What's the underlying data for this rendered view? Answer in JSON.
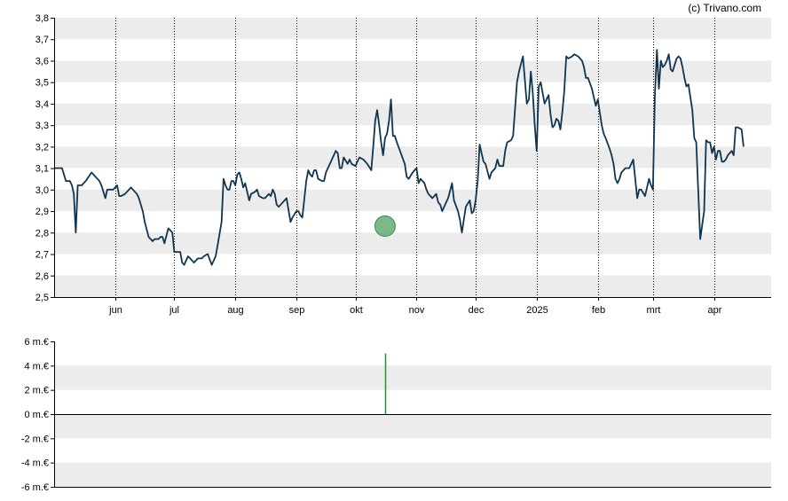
{
  "credit": "(c) Trivano.com",
  "colors": {
    "price_line": "#0f3550",
    "volume_bar": "#2e8b3a",
    "marker": "#5aa86a",
    "band": "#ececec",
    "axis": "#000000",
    "grid": "#000000"
  },
  "chart_data": [
    {
      "type": "line",
      "ylim": [
        2.5,
        3.8
      ],
      "yticks": [
        "2,5",
        "2,6",
        "2,7",
        "2,8",
        "2,9",
        "3,0",
        "3,1",
        "3,2",
        "3,3",
        "3,4",
        "3,5",
        "3,6",
        "3,7",
        "3,8"
      ],
      "ytick_values": [
        2.5,
        2.6,
        2.7,
        2.8,
        2.9,
        3.0,
        3.1,
        3.2,
        3.3,
        3.4,
        3.5,
        3.6,
        3.7,
        3.8
      ],
      "xlim": [
        "2024-05-01",
        "2025-04-30"
      ],
      "xticks": [
        {
          "label": "jun",
          "date": "2024-06-01"
        },
        {
          "label": "jul",
          "date": "2024-07-01"
        },
        {
          "label": "aug",
          "date": "2024-08-01"
        },
        {
          "label": "sep",
          "date": "2024-09-01"
        },
        {
          "label": "okt",
          "date": "2024-10-01"
        },
        {
          "label": "nov",
          "date": "2024-11-01"
        },
        {
          "label": "dec",
          "date": "2024-12-01"
        },
        {
          "label": "2025",
          "date": "2025-01-01"
        },
        {
          "label": "feb",
          "date": "2025-02-01"
        },
        {
          "label": "mrt",
          "date": "2025-03-01"
        },
        {
          "label": "apr",
          "date": "2025-04-01"
        }
      ],
      "grid": "vertical dotted at month starts, alternating horizontal bands",
      "x": [
        "2024-05-01",
        "2024-05-05",
        "2024-05-07",
        "2024-05-09",
        "2024-05-10",
        "2024-05-11",
        "2024-05-12",
        "2024-05-13",
        "2024-05-15",
        "2024-05-17",
        "2024-05-20",
        "2024-05-21",
        "2024-05-22",
        "2024-05-23",
        "2024-05-24",
        "2024-05-25",
        "2024-05-27",
        "2024-05-28",
        "2024-05-29",
        "2024-05-30",
        "2024-05-31",
        "2024-06-02",
        "2024-06-03",
        "2024-06-04",
        "2024-06-06",
        "2024-06-08",
        "2024-06-09",
        "2024-06-10",
        "2024-06-11",
        "2024-06-12",
        "2024-06-13",
        "2024-06-14",
        "2024-06-15",
        "2024-06-16",
        "2024-06-18",
        "2024-06-20",
        "2024-06-21",
        "2024-06-22",
        "2024-06-23",
        "2024-06-24",
        "2024-06-25",
        "2024-06-26",
        "2024-06-28",
        "2024-06-30",
        "2024-07-01",
        "2024-07-02",
        "2024-07-03",
        "2024-07-04",
        "2024-07-05",
        "2024-07-06",
        "2024-07-07",
        "2024-07-08",
        "2024-07-09",
        "2024-07-11",
        "2024-07-13",
        "2024-07-14",
        "2024-07-15",
        "2024-07-16",
        "2024-07-18",
        "2024-07-20",
        "2024-07-22",
        "2024-07-23",
        "2024-07-25",
        "2024-07-26",
        "2024-07-27",
        "2024-07-28",
        "2024-07-29",
        "2024-07-30",
        "2024-07-31",
        "2024-08-01",
        "2024-08-02",
        "2024-08-03",
        "2024-08-04",
        "2024-08-05",
        "2024-08-06",
        "2024-08-08",
        "2024-08-09",
        "2024-08-11",
        "2024-08-12",
        "2024-08-13",
        "2024-08-15",
        "2024-08-16",
        "2024-08-18",
        "2024-08-19",
        "2024-08-20",
        "2024-08-21",
        "2024-08-22",
        "2024-08-23",
        "2024-08-24",
        "2024-08-26",
        "2024-08-27",
        "2024-08-29",
        "2024-08-30",
        "2024-09-01",
        "2024-09-02",
        "2024-09-03",
        "2024-09-04",
        "2024-09-06",
        "2024-09-07",
        "2024-09-08",
        "2024-09-09",
        "2024-09-10",
        "2024-09-11",
        "2024-09-12",
        "2024-09-14",
        "2024-09-15",
        "2024-09-16",
        "2024-09-17",
        "2024-09-19",
        "2024-09-21",
        "2024-09-22",
        "2024-09-23",
        "2024-09-24",
        "2024-09-25",
        "2024-09-27",
        "2024-09-28",
        "2024-09-29",
        "2024-10-01",
        "2024-10-02",
        "2024-10-03",
        "2024-10-05",
        "2024-10-07",
        "2024-10-09",
        "2024-10-10",
        "2024-10-11",
        "2024-10-12",
        "2024-10-13",
        "2024-10-14",
        "2024-10-15",
        "2024-10-16",
        "2024-10-17",
        "2024-10-18",
        "2024-10-19",
        "2024-10-20",
        "2024-10-21",
        "2024-10-22",
        "2024-10-24",
        "2024-10-26",
        "2024-10-27",
        "2024-10-28",
        "2024-10-30",
        "2024-11-01",
        "2024-11-02",
        "2024-11-03",
        "2024-11-05",
        "2024-11-06",
        "2024-11-07",
        "2024-11-09",
        "2024-11-11",
        "2024-11-12",
        "2024-11-13",
        "2024-11-14",
        "2024-11-16",
        "2024-11-17",
        "2024-11-19",
        "2024-11-20",
        "2024-11-22",
        "2024-11-23",
        "2024-11-24",
        "2024-11-26",
        "2024-11-28",
        "2024-11-29",
        "2024-11-30",
        "2024-12-01",
        "2024-12-02",
        "2024-12-03",
        "2024-12-04",
        "2024-12-05",
        "2024-12-06",
        "2024-12-08",
        "2024-12-09",
        "2024-12-11",
        "2024-12-12",
        "2024-12-13",
        "2024-12-15",
        "2024-12-16",
        "2024-12-17",
        "2024-12-19",
        "2024-12-20",
        "2024-12-22",
        "2024-12-23",
        "2024-12-25",
        "2024-12-27",
        "2024-12-28",
        "2024-12-29",
        "2024-12-30",
        "2024-12-31",
        "2025-01-01",
        "2025-01-02",
        "2025-01-03",
        "2025-01-04",
        "2025-01-05",
        "2025-01-06",
        "2025-01-07",
        "2025-01-08",
        "2025-01-09",
        "2025-01-10",
        "2025-01-11",
        "2025-01-12",
        "2025-01-13",
        "2025-01-14",
        "2025-01-15",
        "2025-01-16",
        "2025-01-17",
        "2025-01-19",
        "2025-01-20",
        "2025-01-22",
        "2025-01-24",
        "2025-01-25",
        "2025-01-26",
        "2025-01-27",
        "2025-01-29",
        "2025-01-31",
        "2025-02-01",
        "2025-02-03",
        "2025-02-04",
        "2025-02-05",
        "2025-02-07",
        "2025-02-08",
        "2025-02-09",
        "2025-02-10",
        "2025-02-11",
        "2025-02-12",
        "2025-02-13",
        "2025-02-15",
        "2025-02-17",
        "2025-02-19",
        "2025-02-21",
        "2025-02-22",
        "2025-02-23",
        "2025-02-25",
        "2025-02-27",
        "2025-02-28",
        "2025-03-01",
        "2025-03-02",
        "2025-03-03",
        "2025-03-04",
        "2025-03-05",
        "2025-03-06",
        "2025-03-07",
        "2025-03-08",
        "2025-03-09",
        "2025-03-10",
        "2025-03-11",
        "2025-03-13",
        "2025-03-14",
        "2025-03-15",
        "2025-03-16",
        "2025-03-17",
        "2025-03-18",
        "2025-03-19",
        "2025-03-21",
        "2025-03-22",
        "2025-03-23",
        "2025-03-25",
        "2025-03-27",
        "2025-03-28",
        "2025-03-29",
        "2025-03-30",
        "2025-03-31",
        "2025-04-01",
        "2025-04-02",
        "2025-04-03",
        "2025-04-04",
        "2025-04-05",
        "2025-04-06",
        "2025-04-07",
        "2025-04-08",
        "2025-04-10",
        "2025-04-11",
        "2025-04-12",
        "2025-04-13",
        "2025-04-15",
        "2025-04-16",
        "2025-04-17",
        "2025-04-18",
        "2025-04-20",
        "2025-04-21",
        "2025-04-22",
        "2025-04-23",
        "2025-04-24",
        "2025-04-26",
        "2025-04-28",
        "2025-04-29",
        "2025-04-30"
      ],
      "y": [
        3.1,
        3.1,
        3.04,
        3.04,
        3.02,
        2.98,
        2.8,
        3.02,
        3.02,
        3.04,
        3.08,
        3.07,
        3.06,
        3.05,
        3.04,
        3.02,
        2.96,
        3.0,
        3.0,
        3.0,
        3.0,
        3.02,
        2.97,
        2.97,
        2.98,
        3.0,
        3.01,
        3.0,
        2.99,
        2.98,
        2.96,
        2.93,
        2.9,
        2.85,
        2.78,
        2.76,
        2.77,
        2.77,
        2.77,
        2.78,
        2.78,
        2.75,
        2.82,
        2.8,
        2.71,
        2.71,
        2.71,
        2.71,
        2.66,
        2.65,
        2.67,
        2.69,
        2.68,
        2.66,
        2.68,
        2.68,
        2.68,
        2.69,
        2.7,
        2.65,
        2.69,
        2.74,
        2.85,
        3.05,
        3.02,
        3.0,
        3.0,
        3.04,
        3.04,
        3.02,
        3.07,
        3.08,
        3.05,
        3.01,
        3.03,
        2.95,
        2.98,
        2.99,
        3.0,
        2.97,
        2.96,
        2.96,
        2.98,
        2.97,
        3.0,
        2.98,
        2.93,
        2.92,
        2.93,
        2.95,
        2.96,
        2.85,
        2.87,
        2.9,
        2.9,
        2.88,
        2.87,
        3.04,
        3.09,
        3.07,
        3.06,
        3.09,
        3.09,
        3.05,
        3.04,
        3.04,
        3.08,
        3.1,
        3.14,
        3.18,
        3.17,
        3.1,
        3.1,
        3.15,
        3.12,
        3.14,
        3.12,
        3.11,
        3.13,
        3.15,
        3.14,
        3.12,
        3.09,
        3.2,
        3.32,
        3.37,
        3.3,
        3.22,
        3.16,
        3.24,
        3.26,
        3.32,
        3.42,
        3.25,
        3.25,
        3.22,
        3.17,
        3.12,
        3.06,
        3.05,
        3.08,
        3.1,
        3.03,
        3.05,
        3.03,
        3.0,
        2.98,
        2.96,
        2.98,
        2.94,
        2.93,
        2.9,
        2.94,
        2.96,
        3.03,
        2.95,
        2.9,
        2.86,
        2.8,
        2.92,
        2.95,
        2.89,
        2.9,
        2.95,
        3.04,
        3.21,
        3.17,
        3.13,
        3.12,
        3.05,
        3.08,
        3.1,
        3.14,
        3.11,
        3.11,
        3.18,
        3.22,
        3.23,
        3.25,
        3.5,
        3.55,
        3.62,
        3.4,
        3.42,
        3.55,
        3.45,
        3.3,
        3.18,
        3.48,
        3.5,
        3.45,
        3.4,
        3.42,
        3.44,
        3.35,
        3.29,
        3.3,
        3.33,
        3.32,
        3.28,
        3.36,
        3.46,
        3.62,
        3.61,
        3.62,
        3.63,
        3.62,
        3.6,
        3.57,
        3.52,
        3.52,
        3.47,
        3.39,
        3.42,
        3.3,
        3.26,
        3.24,
        3.19,
        3.16,
        3.12,
        3.05,
        3.03,
        3.05,
        3.08,
        3.1,
        3.1,
        3.14,
        2.96,
        3.0,
        3.0,
        2.97,
        3.05,
        3.02,
        3.0,
        3.44,
        3.65,
        3.47,
        3.6,
        3.57,
        3.58,
        3.6,
        3.63,
        3.56,
        3.55,
        3.61,
        3.62,
        3.61,
        3.57,
        3.52,
        3.48,
        3.49,
        3.37,
        3.24,
        3.22,
        2.77,
        2.9,
        3.23,
        3.22,
        3.22,
        3.17,
        3.2,
        3.14,
        3.18,
        3.18,
        3.13,
        3.13,
        3.14,
        3.16,
        3.18,
        3.16,
        3.29,
        3.29,
        3.28,
        3.2
      ]
    },
    {
      "type": "bar",
      "ylim": [
        -6,
        6
      ],
      "yticks": [
        "6 m.€",
        "4 m.€",
        "2 m.€",
        "0 m.€",
        "-2 m.€",
        "-4 m.€",
        "-6 m.€"
      ],
      "ytick_values": [
        6,
        4,
        2,
        0,
        -2,
        -4,
        -6
      ],
      "unit": "m.€",
      "x": [
        "2024-10-16"
      ],
      "values": [
        5.0
      ]
    }
  ],
  "marker": {
    "date": "2024-10-16",
    "price": 2.83
  }
}
